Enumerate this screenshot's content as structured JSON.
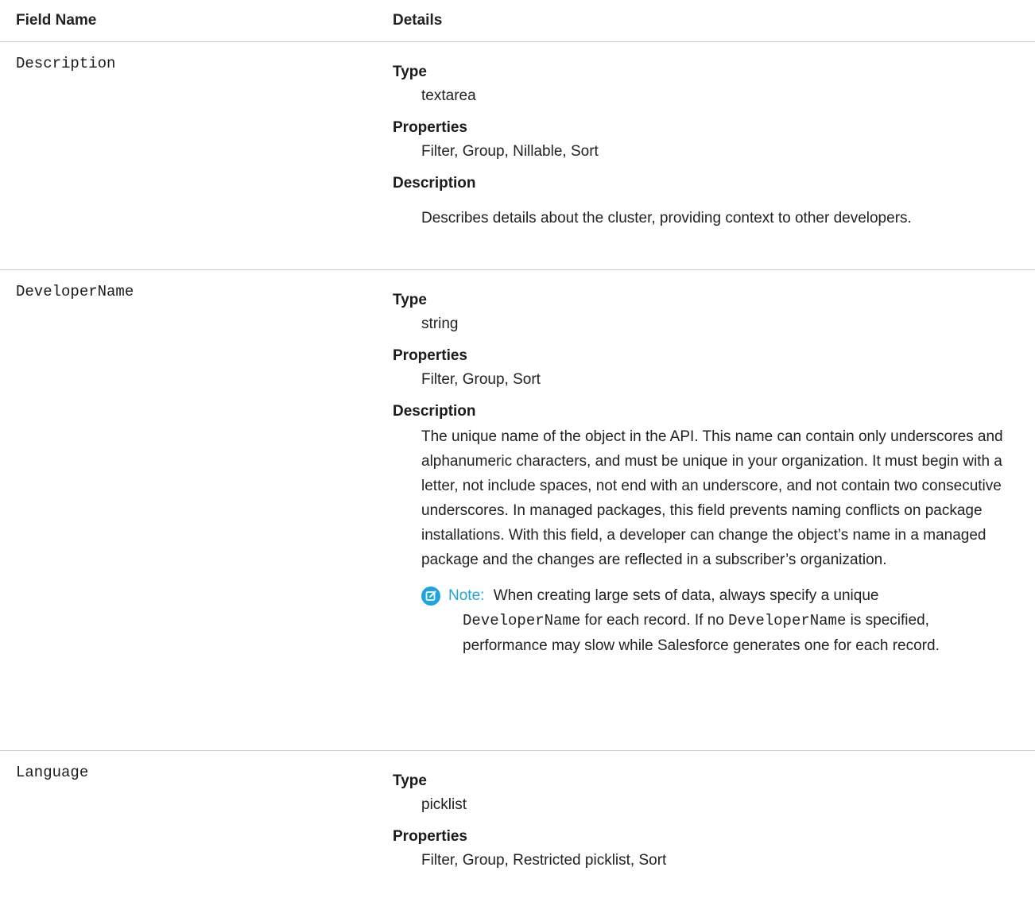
{
  "header": {
    "field_name": "Field Name",
    "details": "Details"
  },
  "rows": [
    {
      "field": "Description",
      "type_label": "Type",
      "type": "textarea",
      "properties_label": "Properties",
      "properties": "Filter, Group, Nillable, Sort",
      "description_label": "Description",
      "description": "Describes details about the cluster, providing context to other developers."
    },
    {
      "field": "DeveloperName",
      "type_label": "Type",
      "type": "string",
      "properties_label": "Properties",
      "properties": "Filter, Group, Sort",
      "description_label": "Description",
      "description": "The unique name of the object in the API. This name can contain only underscores and alphanumeric characters, and must be unique in your organization. It must begin with a letter, not include spaces, not end with an underscore, and not contain two consecutive underscores. In managed packages, this field prevents naming conflicts on package installations. With this field, a developer can change the object’s name in a managed package and the changes are reflected in a subscriber’s organization.",
      "note": {
        "title": "Note:",
        "part1": "When creating large sets of data, always specify a unique",
        "code1": "DeveloperName",
        "part2": "for each record. If no",
        "code2": "DeveloperName",
        "part3": "is specified,",
        "part4": "performance may slow while Salesforce generates one for each record."
      }
    },
    {
      "field": "Language",
      "type_label": "Type",
      "type": "picklist",
      "properties_label": "Properties",
      "properties": "Filter, Group, Restricted picklist, Sort"
    }
  ]
}
